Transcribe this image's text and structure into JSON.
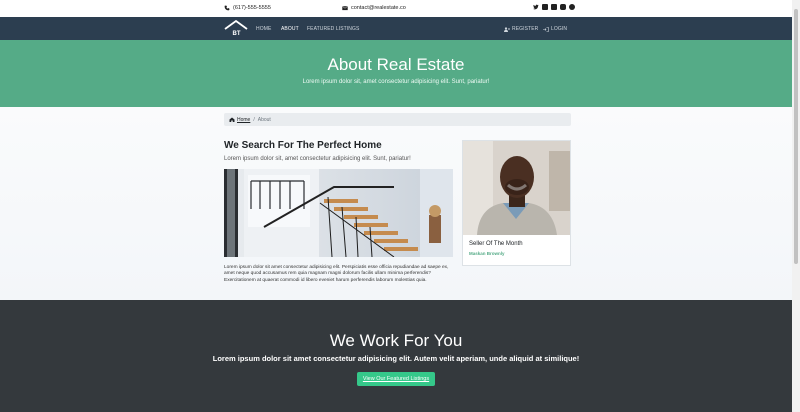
{
  "topbar": {
    "phone": "(617)-555-5555",
    "email": "contact@realestate.co",
    "social_icons": [
      "twitter-icon",
      "facebook-icon",
      "linkedin-icon",
      "instagram-icon",
      "pinterest-icon"
    ]
  },
  "nav": {
    "logo_text": "BT",
    "items": [
      "HOME",
      "ABOUT",
      "FEATURED LISTINGS"
    ],
    "active": "ABOUT",
    "register": "REGISTER",
    "login": "LOGIN"
  },
  "hero": {
    "title": "About Real Estate",
    "subtitle": "Lorem ipsum dolor sit, amet consectetur adipisicing elit. Sunt, pariatur!"
  },
  "breadcrumb": {
    "home": "Home",
    "separator": "/",
    "current": "About"
  },
  "main": {
    "heading": "We Search For The Perfect Home",
    "subheading": "Lorem ipsum dolor sit, amet consectetur adipisicing elit. Sunt, pariatur!",
    "body": "Lorem ipsum dolor sit amet consectetur adipisicing elit. Perspiciatis esse officia repudiandae ad saepe ex, amet neque quod accusamus rem quia magnam magni dolorum facilis ullam minima perferendis? Exercitationem at quaerat commodi id libero eveniet harum perferendis laborum molestias quia."
  },
  "seller": {
    "title": "Seller Of The Month",
    "name": "Maskan Brownly"
  },
  "cta_section": {
    "title": "We Work For You",
    "subtitle": "Lorem ipsum dolor sit amet consectetur adipisicing elit. Autem velit aperiam, unde aliquid at similique!",
    "button": "View Our Featured Listings"
  },
  "colors": {
    "nav": "#2c3e50",
    "hero": "#55ab87",
    "dark": "#34393d",
    "cta": "#35c88a"
  }
}
